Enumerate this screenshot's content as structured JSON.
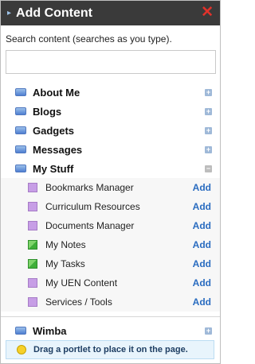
{
  "header": {
    "title": "Add Content",
    "chevron_icon": "chevron-right-icon",
    "close_icon": "close-icon",
    "close_color": "#e0322b"
  },
  "search": {
    "label": "Search content (searches as you type).",
    "value": "",
    "placeholder": ""
  },
  "categories": [
    {
      "label": "About Me",
      "state": "collapsed",
      "toggle": "+"
    },
    {
      "label": "Blogs",
      "state": "collapsed",
      "toggle": "+"
    },
    {
      "label": "Gadgets",
      "state": "collapsed",
      "toggle": "+"
    },
    {
      "label": "Messages",
      "state": "collapsed",
      "toggle": "+"
    },
    {
      "label": "My Stuff",
      "state": "expanded",
      "toggle": "−"
    },
    {
      "label": "Wimba",
      "state": "collapsed",
      "toggle": "+"
    }
  ],
  "mystuff_items": [
    {
      "label": "Bookmarks Manager",
      "action": "Add",
      "icon": "purple-square-icon"
    },
    {
      "label": "Curriculum Resources",
      "action": "Add",
      "icon": "purple-square-icon"
    },
    {
      "label": "Documents Manager",
      "action": "Add",
      "icon": "purple-square-icon"
    },
    {
      "label": "My Notes",
      "action": "Add",
      "icon": "green-square-icon"
    },
    {
      "label": "My Tasks",
      "action": "Add",
      "icon": "green-square-icon"
    },
    {
      "label": "My UEN Content",
      "action": "Add",
      "icon": "purple-square-icon"
    },
    {
      "label": "Services / Tools",
      "action": "Add",
      "icon": "purple-square-icon"
    }
  ],
  "tip": {
    "text": "Drag a portlet to place it on the page.",
    "icon": "lightbulb-icon"
  }
}
